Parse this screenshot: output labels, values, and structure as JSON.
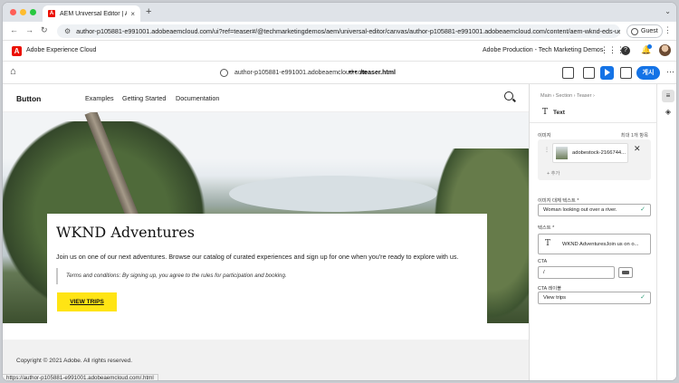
{
  "browser": {
    "tab_title": "AEM Universal Editor | Adobe",
    "tab_close": "×",
    "new_tab": "+",
    "tab_menu": "⌄",
    "url": "author-p105881-e991001.adobeaemcloud.com/ui?ref=teaser#/@techmarketingdemos/aem/universal-editor/canvas/author-p105881-e991001.adobeaemcloud.com/content/aem-wknd-eds-ue/b...",
    "profile_label": "Guest",
    "back": "←",
    "forward": "→",
    "reload": "↻",
    "menu": "⋮",
    "hover_url": "https://author-p105881-e991001.adobeaemcloud.com/.html"
  },
  "shell": {
    "logo": "A",
    "brand": "Adobe Experience Cloud",
    "org": "Adobe Production - Tech Marketing Demos"
  },
  "editor_toolbar": {
    "host": "author-p105881-e991001.adobeaemcloud.com",
    "more_dots": "•••",
    "path": "/teaser.html",
    "publish_label": "게시",
    "more": "⋯"
  },
  "site": {
    "logo_text": "Button",
    "nav": [
      "Examples",
      "Getting Started",
      "Documentation"
    ],
    "teaser": {
      "title": "WKND Adventures",
      "body": "Join us on one of our next adventures. Browse our catalog of curated experiences and sign up for one when you're ready to explore with us.",
      "terms": "Terms and conditions: By signing up, you agree to the rules for participation and booking.",
      "cta_label": "VIEW TRIPS"
    },
    "footer": "Copyright © 2021 Adobe. All rights reserved."
  },
  "panel": {
    "breadcrumb": "Main  ›  Section  ›  Teaser  ›",
    "component_type": "Text",
    "image_label": "이미지",
    "image_limit": "최대 1개 항목",
    "asset_name": "adobestock-2166744...",
    "asset_remove": "✕",
    "add_label": "+ 추가",
    "alt_label": "이미지 대체 텍스트 *",
    "alt_value": "Woman looking out over a river.",
    "text_label": "텍스트 *",
    "text_value": "WKND AdventuresJoin us on o...",
    "cta_label": "CTA",
    "cta_value": "/",
    "cta_text_label": "CTA 레이블",
    "cta_text_value": "View trips",
    "check": "✓"
  },
  "colors": {
    "accent": "#1473e6",
    "adobe_red": "#eb1000",
    "cta_yellow": "#ffe414",
    "valid_green": "#2d9d78"
  },
  "icons": {
    "home": "⌂",
    "grid": "⋮⋮⋮",
    "bell": "🔔",
    "help": "?",
    "properties": "≡",
    "layers": "◈"
  }
}
